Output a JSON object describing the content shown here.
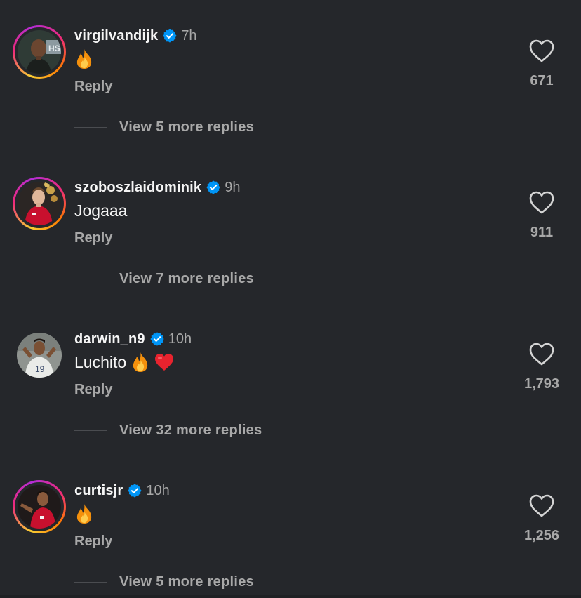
{
  "comments": [
    {
      "username": "virgilvandijk",
      "time": "7h",
      "text": "",
      "emojis": [
        "fire"
      ],
      "reply_label": "Reply",
      "likes": "671",
      "view_replies": "View 5 more replies",
      "story_ring": true
    },
    {
      "username": "szoboszlaidominik",
      "time": "9h",
      "text": "Jogaaa",
      "emojis": [],
      "reply_label": "Reply",
      "likes": "911",
      "view_replies": "View 7 more replies",
      "story_ring": true
    },
    {
      "username": "darwin_n9",
      "time": "10h",
      "text": "Luchito",
      "emojis": [
        "fire",
        "red-heart"
      ],
      "reply_label": "Reply",
      "likes": "1,793",
      "view_replies": "View 32 more replies",
      "story_ring": false
    },
    {
      "username": "curtisjr",
      "time": "10h",
      "text": "",
      "emojis": [
        "fire"
      ],
      "reply_label": "Reply",
      "likes": "1,256",
      "view_replies": "View 5 more replies",
      "story_ring": true
    }
  ],
  "colors": {
    "background": "#25272b",
    "text_primary": "#f5f5f5",
    "text_secondary": "#a8a8a8",
    "verified_blue": "#0095f6"
  },
  "icons": {
    "verified": "verified-badge-icon",
    "like": "heart-outline-icon",
    "fire": "fire-emoji",
    "red_heart": "red-heart-emoji"
  }
}
